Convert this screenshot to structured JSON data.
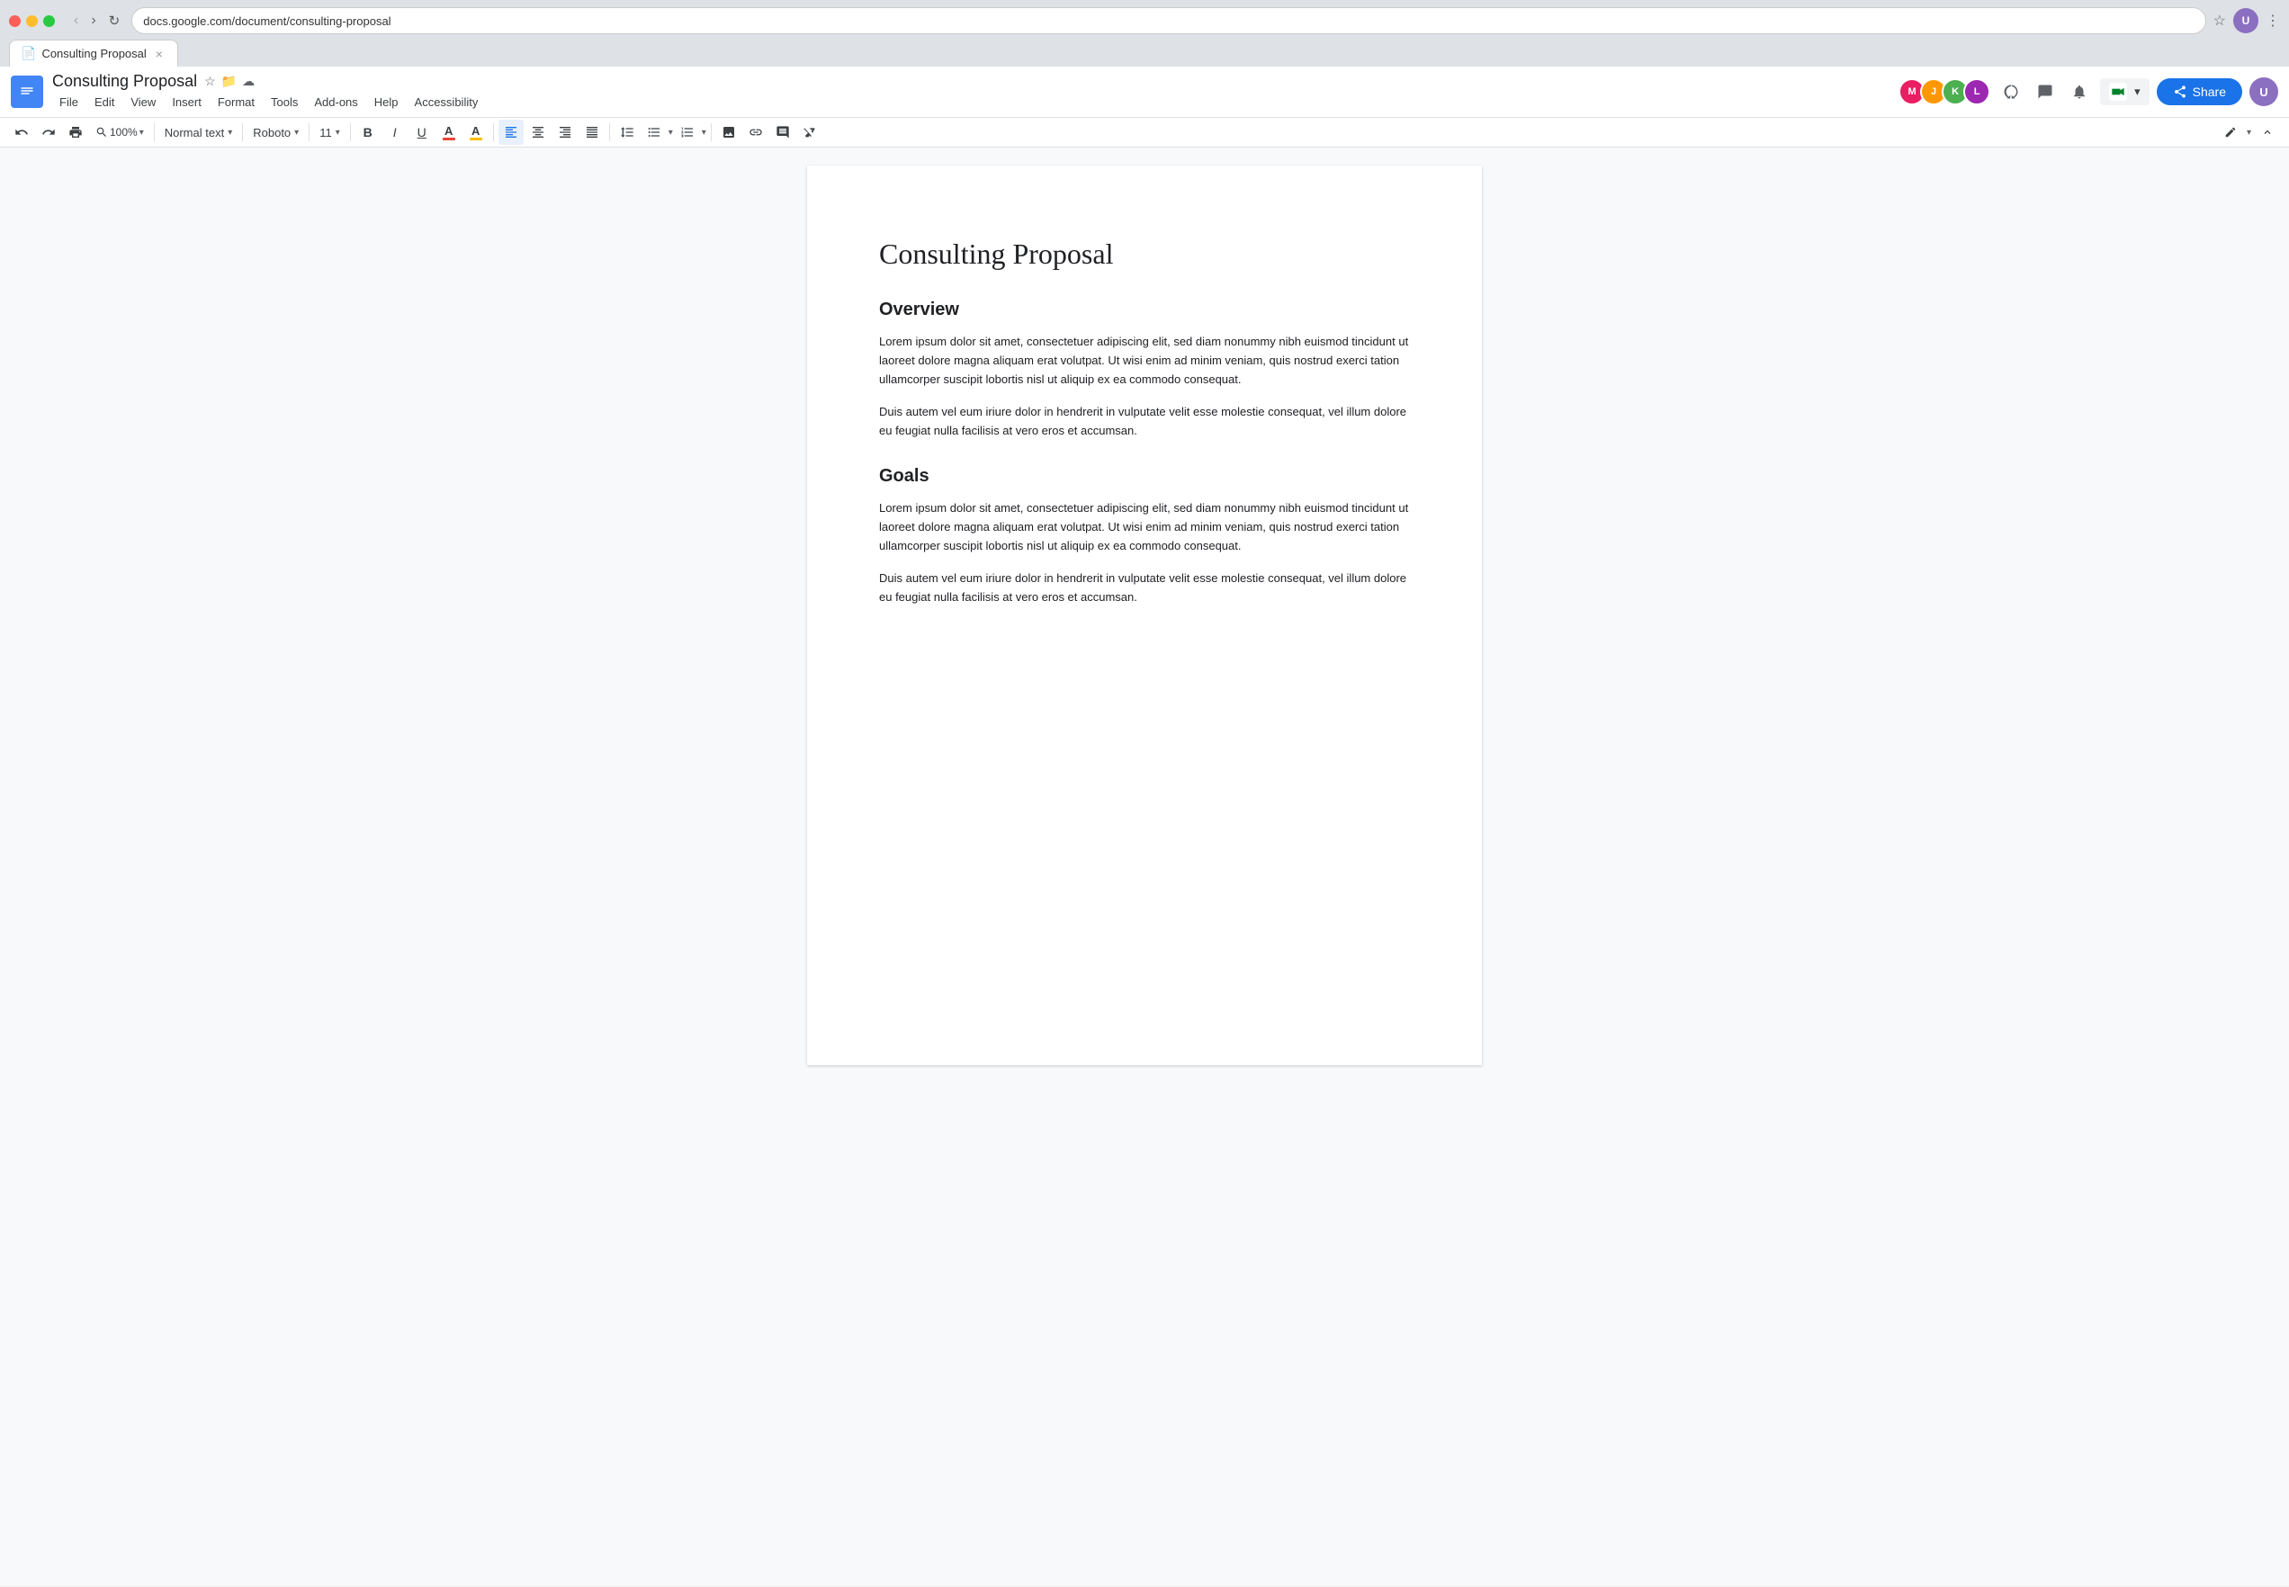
{
  "browser": {
    "tab_title": "Consulting Proposal",
    "tab_icon": "📄",
    "address_bar_placeholder": "docs.google.com/document/consulting-proposal",
    "tab_close": "×"
  },
  "app": {
    "doc_icon": "📄",
    "doc_title": "Consulting Proposal",
    "doc_title_icons": {
      "star": "☆",
      "folder": "📁",
      "cloud": "☁"
    },
    "menu": {
      "file": "File",
      "edit": "Edit",
      "view": "View",
      "insert": "Insert",
      "format": "Format",
      "tools": "Tools",
      "addons": "Add-ons",
      "help": "Help",
      "accessibility": "Accessibility"
    },
    "share_btn": "Share",
    "share_icon": "👤"
  },
  "toolbar": {
    "undo": "↩",
    "redo": "↪",
    "print": "🖨",
    "zoom_value": "100%",
    "text_style": "Normal text",
    "font_name": "Roboto",
    "font_size": "11",
    "bold": "B",
    "italic": "I",
    "underline": "U",
    "text_color_label": "A",
    "highlight_label": "A",
    "align_left": "≡",
    "align_center": "≡",
    "align_right": "≡",
    "align_justify": "≡",
    "line_spacing": "☰",
    "bullet_list": "☰",
    "numbered_list": "☰",
    "insert_image": "🖼",
    "insert_link": "🔗",
    "insert_comment": "💬",
    "clear_format": "✕",
    "edit_pencil": "✏",
    "collapse_up": "⌃"
  },
  "document": {
    "main_title": "Consulting Proposal",
    "sections": [
      {
        "heading": "Overview",
        "paragraphs": [
          "Lorem ipsum dolor sit amet, consectetuer adipiscing elit, sed diam nonummy nibh euismod tincidunt ut laoreet dolore magna aliquam erat volutpat. Ut wisi enim ad minim veniam, quis nostrud exerci tation ullamcorper suscipit lobortis nisl ut aliquip ex ea commodo consequat.",
          "Duis autem vel eum iriure dolor in hendrerit in vulputate velit esse molestie consequat, vel illum dolore eu feugiat nulla facilisis at vero eros et accumsan."
        ]
      },
      {
        "heading": "Goals",
        "paragraphs": [
          "Lorem ipsum dolor sit amet, consectetuer adipiscing elit, sed diam nonummy nibh euismod tincidunt ut laoreet dolore magna aliquam erat volutpat. Ut wisi enim ad minim veniam, quis nostrud exerci tation ullamcorper suscipit lobortis nisl ut aliquip ex ea commodo consequat.",
          "Duis autem vel eum iriure dolor in hendrerit in vulputate velit esse molestie consequat, vel illum dolore eu feugiat nulla facilisis at vero eros et accumsan."
        ]
      }
    ]
  },
  "collaborators": [
    {
      "initials": "M",
      "color": "#e91e63"
    },
    {
      "initials": "J",
      "color": "#ff9800"
    },
    {
      "initials": "K",
      "color": "#4caf50"
    },
    {
      "initials": "L",
      "color": "#9c27b0"
    }
  ],
  "colors": {
    "text_underline_red": "#ea4335",
    "highlight_yellow": "#fbbc04",
    "accent_blue": "#1a73e8"
  }
}
